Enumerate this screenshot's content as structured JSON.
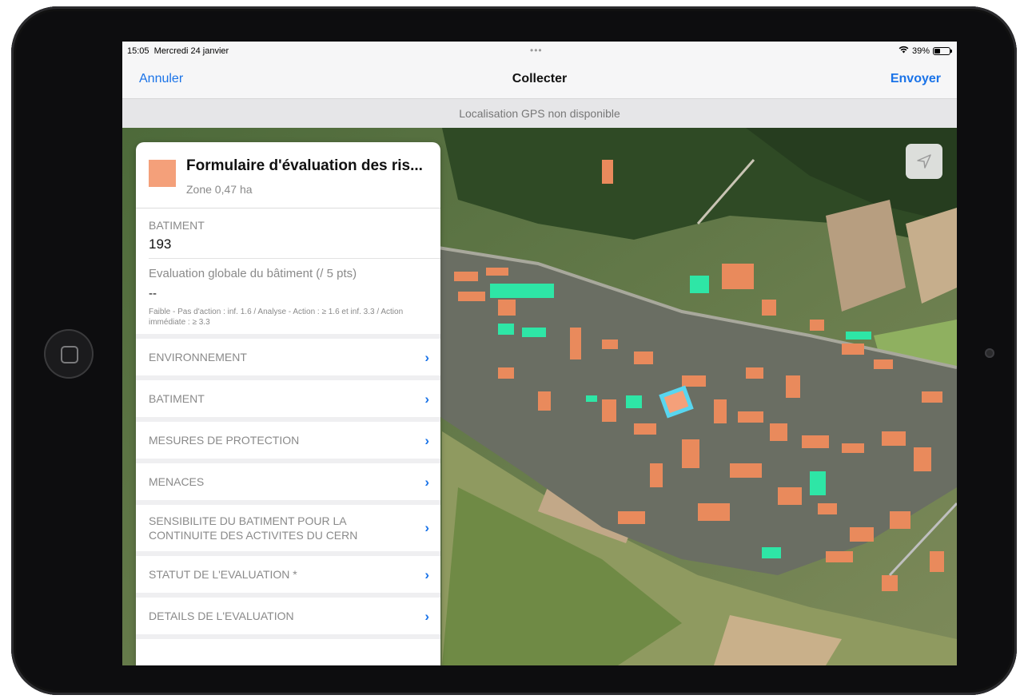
{
  "status": {
    "time": "15:05",
    "date": "Mercredi 24 janvier",
    "battery": "39%",
    "battery_level": 0.39
  },
  "nav": {
    "cancel": "Annuler",
    "title": "Collecter",
    "send": "Envoyer"
  },
  "gps_message": "Localisation GPS non disponible",
  "icons": {
    "locate": "location-arrow-icon",
    "chevron": "chevron-right-icon",
    "wifi": "wifi-icon",
    "battery": "battery-icon"
  },
  "colors": {
    "accent": "#1a73e8",
    "building": "#f4a07a",
    "highlight": "#2ee6a6"
  },
  "form": {
    "title": "Formulaire d'évaluation des ris...",
    "zone": "Zone 0,47 ha",
    "batiment_label": "BATIMENT",
    "batiment_value": "193",
    "evaluation_label": "Evaluation globale du bâtiment (/ 5 pts)",
    "evaluation_value": "--",
    "evaluation_hint": "Faible - Pas d'action : inf. 1.6  /  Analyse - Action : ≥ 1.6 et inf. 3.3  /  Action immédiate : ≥ 3.3",
    "groups": [
      {
        "label": "ENVIRONNEMENT"
      },
      {
        "label": "BATIMENT"
      },
      {
        "label": "MESURES DE PROTECTION"
      },
      {
        "label": "MENACES"
      },
      {
        "label": "SENSIBILITE DU BATIMENT POUR LA CONTINUITE DES ACTIVITES DU CERN"
      },
      {
        "label": "STATUT DE L'EVALUATION *"
      },
      {
        "label": "DETAILS DE L'EVALUATION"
      }
    ]
  }
}
